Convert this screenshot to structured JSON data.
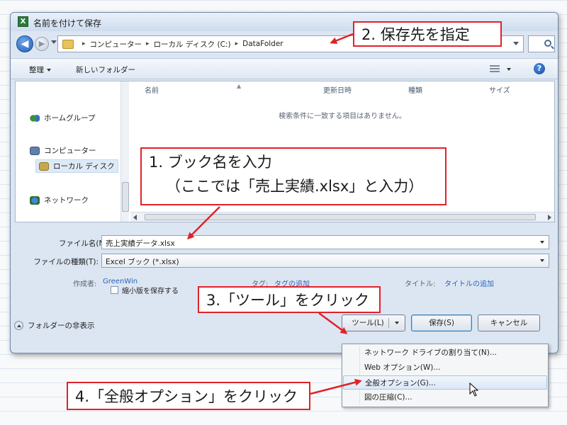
{
  "window": {
    "title": "名前を付けて保存",
    "app_icon": "X"
  },
  "address": {
    "back_glyph": "◀",
    "forward_glyph": "▶",
    "crumbs": [
      "コンピューター",
      "ローカル ディスク (C:)",
      "DataFolder"
    ],
    "separator": "▸"
  },
  "toolbar": {
    "organize_label": "整理",
    "new_folder_label": "新しいフォルダー",
    "help_glyph": "?"
  },
  "nav": {
    "items": [
      "ホームグループ",
      "コンピューター",
      "ローカル ディスク",
      "ネットワーク"
    ]
  },
  "columns": {
    "name": "名前",
    "date": "更新日時",
    "type": "種類",
    "size": "サイズ"
  },
  "file_list": {
    "empty_message": "検索条件に一致する項目はありません。"
  },
  "form": {
    "filename_label": "ファイル名(N):",
    "filename_value": "売上実績データ.xlsx",
    "filetype_label": "ファイルの種類(T):",
    "filetype_value": "Excel ブック (*.xlsx)",
    "author_label": "作成者:",
    "author_value": "GreenWin",
    "tags_label": "タグ:",
    "tags_value": "タグの追加",
    "title_label": "タイトル:",
    "title_value": "タイトルの追加",
    "thumbnail_label": "縮小版を保存する"
  },
  "footer": {
    "hide_folders_label": "フォルダーの非表示",
    "tools_label": "ツール(L)",
    "save_label": "保存(S)",
    "cancel_label": "キャンセル"
  },
  "tools_menu": {
    "items": [
      "ネットワーク ドライブの割り当て(N)...",
      "Web オプション(W)...",
      "全般オプション(G)...",
      "図の圧縮(C)..."
    ],
    "hovered_index": 2
  },
  "callouts": {
    "step1_line1": "1. ブック名を入力",
    "step1_line2": "（ここでは「売上実績.xlsx」と入力）",
    "step2": "2. 保存先を指定",
    "step3": "3.「ツール」をクリック",
    "step4": "4.「全般オプション」をクリック"
  },
  "colors": {
    "callout_border": "#e0222a",
    "link": "#2a64b8",
    "dialog_bg": "#dce6f2"
  }
}
